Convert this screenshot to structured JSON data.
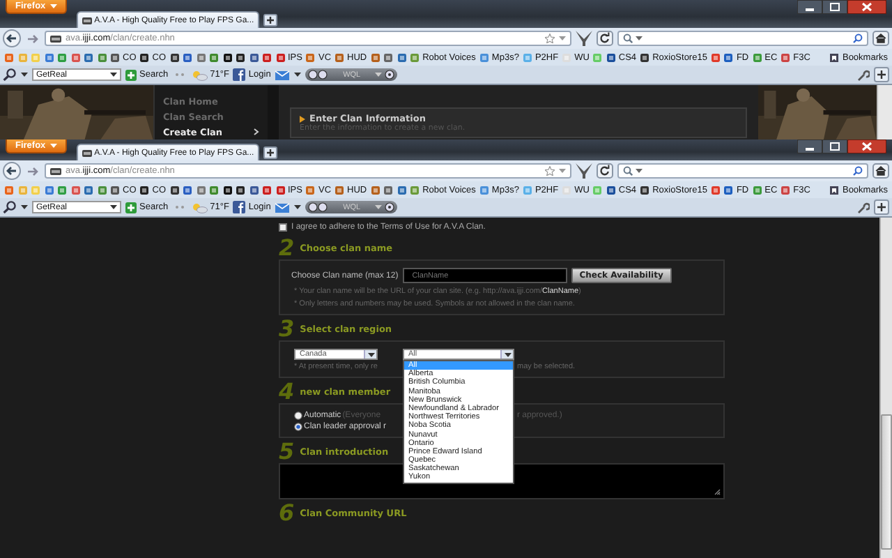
{
  "windows": [
    {
      "firefox_button": "Firefox",
      "tab_title": "A.V.A - High Quality Free to Play FPS Ga...",
      "address": "ava.**ijji.com**/clan/create.nhn",
      "bookmarks": [
        {
          "kind": "icon"
        },
        {
          "kind": "icon"
        },
        {
          "kind": "icon"
        },
        {
          "kind": "icon"
        },
        {
          "kind": "icon"
        },
        {
          "kind": "icon"
        },
        {
          "kind": "icon"
        },
        {
          "kind": "icon"
        },
        {
          "kind": "link",
          "label": "CO"
        },
        {
          "kind": "link",
          "label": "CO"
        },
        {
          "kind": "icon"
        },
        {
          "kind": "icon"
        },
        {
          "kind": "icon"
        },
        {
          "kind": "icon"
        },
        {
          "kind": "icon"
        },
        {
          "kind": "icon"
        },
        {
          "kind": "icon"
        },
        {
          "kind": "icon"
        },
        {
          "kind": "link",
          "label": "IPS"
        },
        {
          "kind": "link",
          "label": "VC"
        },
        {
          "kind": "link",
          "label": "HUD"
        },
        {
          "kind": "icon"
        },
        {
          "kind": "icon"
        },
        {
          "kind": "icon"
        },
        {
          "kind": "link",
          "label": "Robot Voices"
        },
        {
          "kind": "link",
          "label": "Mp3s?"
        },
        {
          "kind": "link",
          "label": "P2HF"
        },
        {
          "kind": "link",
          "label": "WU"
        },
        {
          "kind": "icon"
        },
        {
          "kind": "link",
          "label": "CS4"
        },
        {
          "kind": "link",
          "label": "RoxioStore15"
        },
        {
          "kind": "icon"
        },
        {
          "kind": "link",
          "label": "FD"
        },
        {
          "kind": "link",
          "label": "EC"
        },
        {
          "kind": "link",
          "label": "F3C"
        }
      ],
      "bookmarks_menu": "Bookmarks",
      "toolbar": {
        "search_engine": "GetReal",
        "search_button": "Search",
        "temperature": "71°F",
        "login": "Login",
        "widget": "WQL"
      }
    },
    {
      "firefox_button": "Firefox",
      "tab_title": "A.V.A - High Quality Free to Play FPS Ga...",
      "address": "ava.**ijji.com**/clan/create.nhn",
      "bookmarks": [
        {
          "kind": "icon"
        },
        {
          "kind": "icon"
        },
        {
          "kind": "icon"
        },
        {
          "kind": "icon"
        },
        {
          "kind": "icon"
        },
        {
          "kind": "icon"
        },
        {
          "kind": "icon"
        },
        {
          "kind": "icon"
        },
        {
          "kind": "link",
          "label": "CO"
        },
        {
          "kind": "link",
          "label": "CO"
        },
        {
          "kind": "icon"
        },
        {
          "kind": "icon"
        },
        {
          "kind": "icon"
        },
        {
          "kind": "icon"
        },
        {
          "kind": "icon"
        },
        {
          "kind": "icon"
        },
        {
          "kind": "icon"
        },
        {
          "kind": "icon"
        },
        {
          "kind": "link",
          "label": "IPS"
        },
        {
          "kind": "link",
          "label": "VC"
        },
        {
          "kind": "link",
          "label": "HUD"
        },
        {
          "kind": "icon"
        },
        {
          "kind": "icon"
        },
        {
          "kind": "icon"
        },
        {
          "kind": "link",
          "label": "Robot Voices"
        },
        {
          "kind": "link",
          "label": "Mp3s?"
        },
        {
          "kind": "link",
          "label": "P2HF"
        },
        {
          "kind": "link",
          "label": "WU"
        },
        {
          "kind": "icon"
        },
        {
          "kind": "link",
          "label": "CS4"
        },
        {
          "kind": "link",
          "label": "RoxioStore15"
        },
        {
          "kind": "icon"
        },
        {
          "kind": "link",
          "label": "FD"
        },
        {
          "kind": "link",
          "label": "EC"
        },
        {
          "kind": "link",
          "label": "F3C"
        }
      ],
      "bookmarks_menu": "Bookmarks",
      "toolbar": {
        "search_engine": "GetReal",
        "search_button": "Search",
        "temperature": "71°F",
        "login": "Login",
        "widget": "WQL"
      }
    }
  ],
  "top_page": {
    "menu": [
      {
        "label": "Clan Home",
        "selected": false
      },
      {
        "label": "Clan Search",
        "selected": false
      },
      {
        "label": "Create Clan",
        "selected": true
      }
    ],
    "panel_title": "Enter Clan Information",
    "panel_subtitle": "Enter the information to create a new clan."
  },
  "form": {
    "terms": {
      "label": "I agree to adhere to the Terms of Use for A.V.A Clan.",
      "checked": false
    },
    "name_section": {
      "number": "2",
      "title": "Choose clan name",
      "label": "Choose Clan name (max 12)",
      "placeholder": "ClanName",
      "button": "Check Availability",
      "notes": [
        "* Your clan name will be the URL of your clan site. (e.g. http://ava.ijji.com/**ClanName**)",
        "* Only letters and numbers may be used. Symbols ar not allowed in the clan name."
      ]
    },
    "region_section": {
      "number": "3",
      "title": "Select clan region",
      "country": "Canada",
      "province": {
        "value": "All",
        "expanded": true,
        "options": [
          {
            "label": "All",
            "selected": true
          },
          {
            "label": "Alberta",
            "selected": false
          },
          {
            "label": "British Columbia",
            "selected": false
          },
          {
            "label": "Manitoba",
            "selected": false
          },
          {
            "label": "New Brunswick",
            "selected": false
          },
          {
            "label": "Newfoundland & Labrador",
            "selected": false
          },
          {
            "label": "Northwest Territories",
            "selected": false
          },
          {
            "label": "Noba Scotia",
            "selected": false
          },
          {
            "label": "Nunavut",
            "selected": false
          },
          {
            "label": "Ontario",
            "selected": false
          },
          {
            "label": "Prince Edward Island",
            "selected": false
          },
          {
            "label": "Quebec",
            "selected": false
          },
          {
            "label": "Saskatchewan",
            "selected": false
          },
          {
            "label": "Yukon",
            "selected": false
          }
        ]
      },
      "note_start": "* At present time, only re",
      "note_end": "may be selected."
    },
    "member_section": {
      "number": "4",
      "title": "new clan member",
      "options": [
        {
          "label": "Automatic",
          "detail_start": "(Everyone",
          "detail_end": "r approved.)",
          "selected": false
        },
        {
          "label": "Clan leader approval r",
          "selected": true
        }
      ]
    },
    "intro_section": {
      "number": "5",
      "title": "Clan introduction"
    },
    "url_section": {
      "number": "6",
      "title": "Clan Community URL"
    }
  }
}
